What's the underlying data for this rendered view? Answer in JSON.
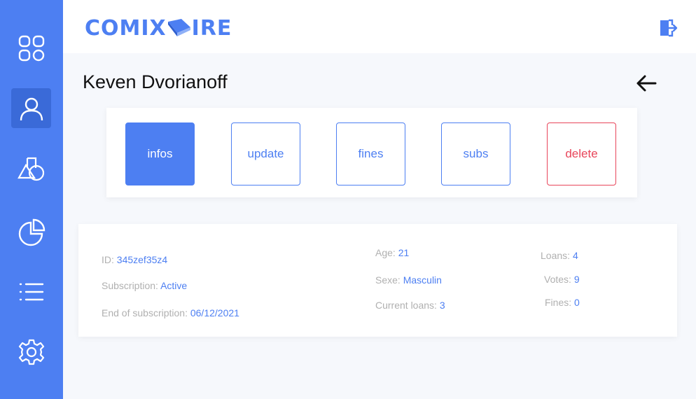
{
  "brand": {
    "logo_left": "COMIX",
    "logo_right": "IRE"
  },
  "sidebar": {
    "items": [
      {
        "name": "dashboard",
        "icon": "grid-icon",
        "active": false
      },
      {
        "name": "users",
        "icon": "user-icon",
        "active": true
      },
      {
        "name": "catalog",
        "icon": "shapes-icon",
        "active": false
      },
      {
        "name": "stats",
        "icon": "pie-chart-icon",
        "active": false
      },
      {
        "name": "list",
        "icon": "list-icon",
        "active": false
      },
      {
        "name": "settings",
        "icon": "gear-icon",
        "active": false
      }
    ]
  },
  "page": {
    "title": "Keven Dvorianoff"
  },
  "tabs": [
    {
      "label": "infos",
      "state": "active"
    },
    {
      "label": "update",
      "state": "normal"
    },
    {
      "label": "fines",
      "state": "normal"
    },
    {
      "label": "subs",
      "state": "normal"
    },
    {
      "label": "delete",
      "state": "danger"
    }
  ],
  "info": {
    "id_label": "ID:",
    "id_value": "345zef35z4",
    "subscription_label": "Subscription:",
    "subscription_value": "Active",
    "end_label": "End of subscription:",
    "end_value": "06/12/2021",
    "age_label": "Age:",
    "age_value": "21",
    "sexe_label": "Sexe:",
    "sexe_value": "Masculin",
    "current_loans_label": "Current loans:",
    "current_loans_value": "3",
    "loans_label": "Loans:",
    "loans_value": "4",
    "votes_label": "Votes:",
    "votes_value": "9",
    "fines_label": "Fines:",
    "fines_value": "0"
  },
  "colors": {
    "primary": "#4d7ff2",
    "danger": "#e8455a",
    "muted": "#b0b0b0"
  }
}
